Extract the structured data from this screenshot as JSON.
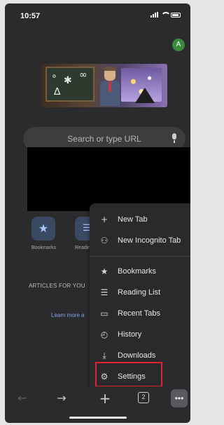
{
  "status_bar": {
    "time": "10:57"
  },
  "profile": {
    "initial": "A"
  },
  "search": {
    "placeholder": "Search or type URL"
  },
  "shortcuts": [
    {
      "label": "Bookmarks",
      "icon": "star-icon"
    },
    {
      "label": "Readin",
      "icon": "reading-list-icon"
    }
  ],
  "feed": {
    "articles_heading": "ARTICLES FOR YOU",
    "learn_more": "Learn more a"
  },
  "menu": {
    "items": [
      {
        "label": "New Tab",
        "icon": "plus-icon",
        "glyph": "+"
      },
      {
        "label": "New Incognito Tab",
        "icon": "incognito-icon",
        "glyph": "⚇"
      },
      {
        "label": "Bookmarks",
        "icon": "star-icon",
        "glyph": "★"
      },
      {
        "label": "Reading List",
        "icon": "reading-list-icon",
        "glyph": "☰"
      },
      {
        "label": "Recent Tabs",
        "icon": "recent-tabs-icon",
        "glyph": "▭"
      },
      {
        "label": "History",
        "icon": "history-icon",
        "glyph": "◴"
      },
      {
        "label": "Downloads",
        "icon": "download-icon",
        "glyph": "⤓"
      },
      {
        "label": "Settings",
        "icon": "gear-icon",
        "glyph": "⚙"
      }
    ],
    "highlighted": "Settings",
    "highlight_color": "#e0242a"
  },
  "toolbar": {
    "tab_count": "2",
    "back": "←",
    "forward": "→",
    "new_tab": "+",
    "more": "•••"
  }
}
